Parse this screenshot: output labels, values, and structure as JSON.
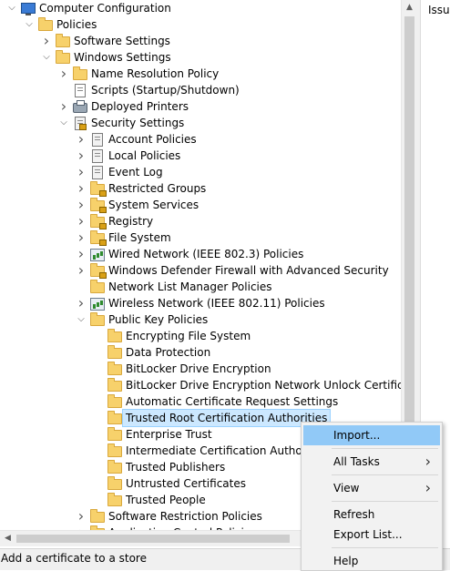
{
  "tree": [
    {
      "label": "Computer Configuration",
      "level": 0,
      "chevron": "down",
      "icon": "computer-icon"
    },
    {
      "label": "Policies",
      "level": 1,
      "chevron": "down",
      "icon": "folder-icon"
    },
    {
      "label": "Software Settings",
      "level": 2,
      "chevron": "right",
      "icon": "folder-icon"
    },
    {
      "label": "Windows Settings",
      "level": 2,
      "chevron": "down",
      "icon": "folder-icon"
    },
    {
      "label": "Name Resolution Policy",
      "level": 3,
      "chevron": "right",
      "icon": "folder-icon"
    },
    {
      "label": "Scripts (Startup/Shutdown)",
      "level": 3,
      "chevron": "",
      "icon": "script-icon"
    },
    {
      "label": "Deployed Printers",
      "level": 3,
      "chevron": "right",
      "icon": "printer-icon"
    },
    {
      "label": "Security Settings",
      "level": 3,
      "chevron": "down",
      "icon": "security-settings-icon"
    },
    {
      "label": "Account Policies",
      "level": 4,
      "chevron": "right",
      "icon": "policy-doc-icon"
    },
    {
      "label": "Local Policies",
      "level": 4,
      "chevron": "right",
      "icon": "policy-doc-icon"
    },
    {
      "label": "Event Log",
      "level": 4,
      "chevron": "right",
      "icon": "policy-doc-icon"
    },
    {
      "label": "Restricted Groups",
      "level": 4,
      "chevron": "right",
      "icon": "locked-folder-icon"
    },
    {
      "label": "System Services",
      "level": 4,
      "chevron": "right",
      "icon": "locked-folder-icon"
    },
    {
      "label": "Registry",
      "level": 4,
      "chevron": "right",
      "icon": "locked-folder-icon"
    },
    {
      "label": "File System",
      "level": 4,
      "chevron": "right",
      "icon": "locked-folder-icon"
    },
    {
      "label": "Wired Network (IEEE 802.3) Policies",
      "level": 4,
      "chevron": "right",
      "icon": "network-policy-icon"
    },
    {
      "label": "Windows Defender Firewall with Advanced Security",
      "level": 4,
      "chevron": "right",
      "icon": "locked-folder-icon"
    },
    {
      "label": "Network List Manager Policies",
      "level": 4,
      "chevron": "",
      "icon": "folder-icon"
    },
    {
      "label": "Wireless Network (IEEE 802.11) Policies",
      "level": 4,
      "chevron": "right",
      "icon": "network-policy-icon"
    },
    {
      "label": "Public Key Policies",
      "level": 4,
      "chevron": "down",
      "icon": "folder-icon"
    },
    {
      "label": "Encrypting File System",
      "level": 5,
      "chevron": "",
      "icon": "folder-icon"
    },
    {
      "label": "Data Protection",
      "level": 5,
      "chevron": "",
      "icon": "folder-icon"
    },
    {
      "label": "BitLocker Drive Encryption",
      "level": 5,
      "chevron": "",
      "icon": "folder-icon"
    },
    {
      "label": "BitLocker Drive Encryption Network Unlock Certificate",
      "level": 5,
      "chevron": "",
      "icon": "folder-icon"
    },
    {
      "label": "Automatic Certificate Request Settings",
      "level": 5,
      "chevron": "",
      "icon": "folder-icon"
    },
    {
      "label": "Trusted Root Certification Authorities",
      "level": 5,
      "chevron": "",
      "icon": "folder-icon",
      "selected": true
    },
    {
      "label": "Enterprise Trust",
      "level": 5,
      "chevron": "",
      "icon": "folder-icon"
    },
    {
      "label": "Intermediate Certification Authorities",
      "level": 5,
      "chevron": "",
      "icon": "folder-icon"
    },
    {
      "label": "Trusted Publishers",
      "level": 5,
      "chevron": "",
      "icon": "folder-icon"
    },
    {
      "label": "Untrusted Certificates",
      "level": 5,
      "chevron": "",
      "icon": "folder-icon"
    },
    {
      "label": "Trusted People",
      "level": 5,
      "chevron": "",
      "icon": "folder-icon"
    },
    {
      "label": "Software Restriction Policies",
      "level": 4,
      "chevron": "right",
      "icon": "folder-icon"
    },
    {
      "label": "Application Control Policies",
      "level": 4,
      "chevron": "right",
      "icon": "folder-icon"
    }
  ],
  "right_pane": {
    "header": "Issued To"
  },
  "status_bar": {
    "text": "Add a certificate to a store"
  },
  "context_menu": [
    {
      "label": "Import...",
      "highlighted": true,
      "submenu": false
    },
    {
      "separator": true
    },
    {
      "label": "All Tasks",
      "submenu": true
    },
    {
      "separator": true
    },
    {
      "label": "View",
      "submenu": true
    },
    {
      "separator": true
    },
    {
      "label": "Refresh",
      "submenu": false
    },
    {
      "label": "Export List...",
      "submenu": false
    },
    {
      "separator": true
    },
    {
      "label": "Help",
      "submenu": false
    }
  ],
  "colors": {
    "selection": "#cce8ff",
    "menu_highlight": "#91c9f7",
    "folder": "#f7d16b"
  }
}
